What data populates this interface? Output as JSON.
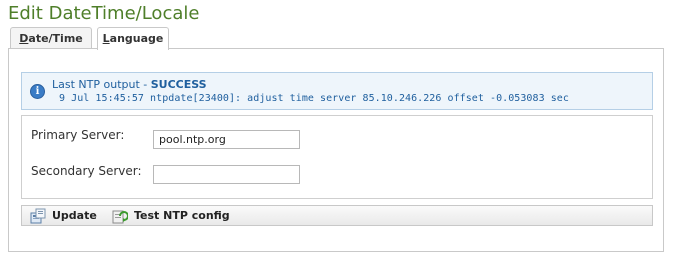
{
  "page": {
    "title": "Edit DateTime/Locale"
  },
  "tabs": [
    {
      "label_ul": "D",
      "label_rest": "ate/Time"
    },
    {
      "label_ul": "L",
      "label_rest": "anguage"
    }
  ],
  "info": {
    "prefix": "Last NTP output - ",
    "status": "SUCCESS",
    "detail": " 9 Jul 15:45:57 ntpdate[23400]: adjust time server 85.10.246.226 offset -0.053083 sec"
  },
  "form": {
    "primary_label": "Primary Server:",
    "primary_value": "pool.ntp.org",
    "secondary_label": "Secondary Server:",
    "secondary_value": ""
  },
  "toolbar": {
    "update_label": "Update",
    "test_label": "Test NTP config"
  },
  "icons": {
    "info": "info-icon",
    "update": "update-icon",
    "test": "test-ntp-icon"
  }
}
